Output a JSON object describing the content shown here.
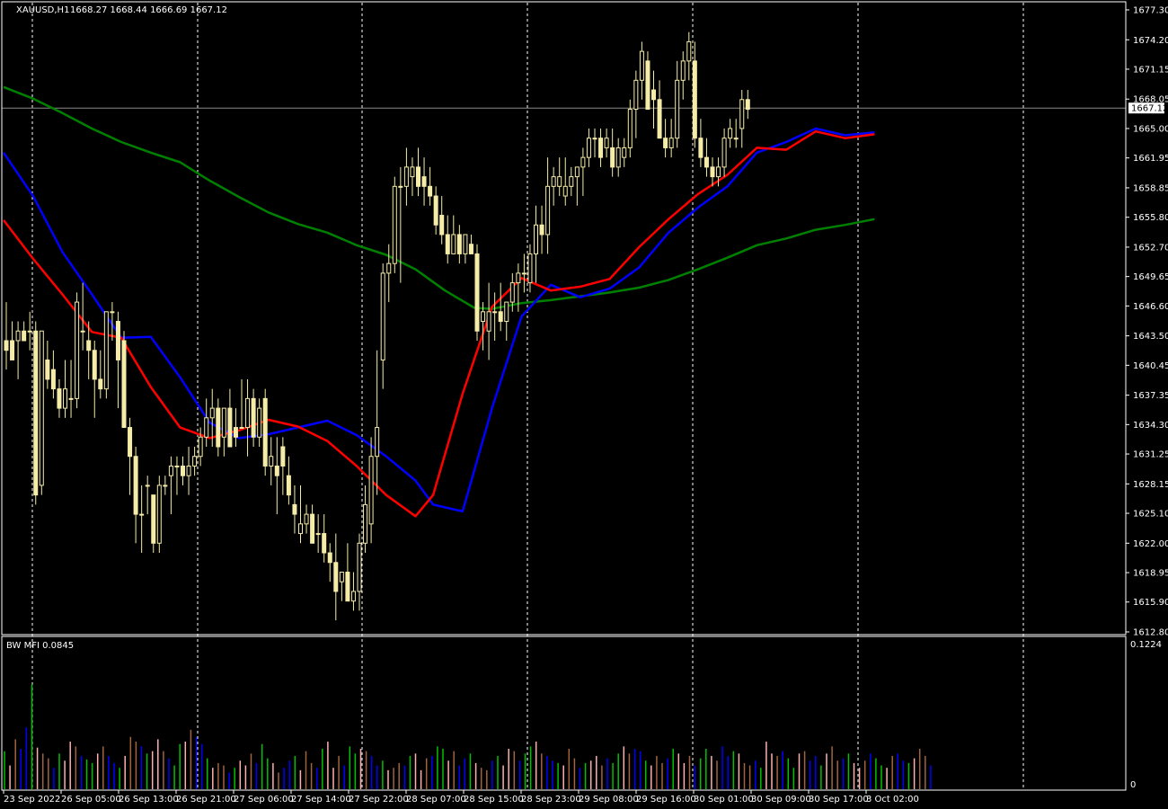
{
  "header": {
    "symbol": "XAUUSD,H1",
    "ohlc": "1668.27 1668.44 1666.69 1667.12"
  },
  "indicator": {
    "title": "BW MFI 0.0845",
    "scale_max": "0.1224",
    "scale_zero": "0"
  },
  "colors": {
    "background": "#000000",
    "frame": "#ffffff",
    "candle": "#f5eca8",
    "ma_fast": "#ff0000",
    "ma_mid": "#0000ff",
    "ma_slow": "#008000",
    "mfi_green": "#00c000",
    "mfi_blue": "#0000ff",
    "mfi_brown": "#a06440",
    "mfi_pink": "#ffb0b0",
    "grid": "#ffffff",
    "price_line": "#8a8a8a"
  },
  "chart_data": {
    "type": "candlestick",
    "symbol": "XAUUSD",
    "timeframe": "H1",
    "y_range": [
      1612.8,
      1677.3
    ],
    "y_ticks": [
      "1677.30",
      "1674.20",
      "1671.15",
      "1668.05",
      "1665.00",
      "1661.95",
      "1658.85",
      "1655.80",
      "1652.70",
      "1649.65",
      "1646.60",
      "1643.50",
      "1640.45",
      "1637.35",
      "1634.30",
      "1631.25",
      "1628.15",
      "1625.10",
      "1622.00",
      "1618.95",
      "1615.90",
      "1612.80"
    ],
    "x_labels": [
      "23 Sep 2022",
      "26 Sep 05:00",
      "26 Sep 13:00",
      "26 Sep 21:00",
      "27 Sep 06:00",
      "27 Sep 14:00",
      "27 Sep 22:00",
      "28 Sep 07:00",
      "28 Sep 15:00",
      "28 Sep 23:00",
      "29 Sep 08:00",
      "29 Sep 16:00",
      "30 Sep 01:00",
      "30 Sep 09:00",
      "30 Sep 17:00",
      "3 Oct 02:00"
    ],
    "current_price": "1667.12",
    "grid": "vertical dotted",
    "candles": [
      [
        1643,
        1647,
        1640,
        1642
      ],
      [
        1643,
        1645,
        1641,
        1641
      ],
      [
        1643,
        1645,
        1639,
        1644
      ],
      [
        1644,
        1645,
        1643,
        1643
      ],
      [
        1644,
        1646,
        1642,
        1644
      ],
      [
        1644,
        1645,
        1626,
        1627
      ],
      [
        1628,
        1644,
        1627,
        1644
      ],
      [
        1641,
        1643,
        1638,
        1639
      ],
      [
        1640,
        1642,
        1637,
        1638
      ],
      [
        1638,
        1639,
        1635,
        1636
      ],
      [
        1636,
        1641,
        1635,
        1638
      ],
      [
        1637,
        1641,
        1635,
        1637
      ],
      [
        1637,
        1648,
        1636,
        1647
      ],
      [
        1644,
        1649,
        1642,
        1644
      ],
      [
        1643,
        1645,
        1639,
        1642
      ],
      [
        1642,
        1643,
        1635,
        1639
      ],
      [
        1639,
        1642,
        1637,
        1638
      ],
      [
        1638,
        1646,
        1637,
        1646
      ],
      [
        1646,
        1647,
        1643,
        1646
      ],
      [
        1645,
        1646,
        1636,
        1641
      ],
      [
        1643,
        1644,
        1634,
        1634
      ],
      [
        1634,
        1635,
        1627,
        1631
      ],
      [
        1631,
        1632,
        1622,
        1625
      ],
      [
        1625,
        1628,
        1621,
        1625
      ],
      [
        1628,
        1629,
        1625,
        1628
      ],
      [
        1627,
        1627,
        1621,
        1622
      ],
      [
        1622,
        1629,
        1621,
        1628
      ],
      [
        1628,
        1629,
        1627,
        1628
      ],
      [
        1629,
        1631,
        1625,
        1630
      ],
      [
        1630,
        1631,
        1627,
        1630
      ],
      [
        1630,
        1631,
        1628,
        1629
      ],
      [
        1629,
        1632,
        1627,
        1630
      ],
      [
        1630,
        1632,
        1629,
        1631
      ],
      [
        1631,
        1634,
        1630,
        1633
      ],
      [
        1633,
        1637,
        1632,
        1635
      ],
      [
        1635,
        1638,
        1632,
        1636
      ],
      [
        1636,
        1637,
        1631,
        1632
      ],
      [
        1633,
        1636,
        1631,
        1636
      ],
      [
        1636,
        1638,
        1632,
        1632
      ],
      [
        1634,
        1636,
        1632,
        1633
      ],
      [
        1634,
        1639,
        1634,
        1634
      ],
      [
        1634,
        1639,
        1631,
        1637
      ],
      [
        1637,
        1638,
        1632,
        1633
      ],
      [
        1633,
        1637,
        1632,
        1636
      ],
      [
        1637,
        1638,
        1629,
        1630
      ],
      [
        1630,
        1633,
        1628,
        1631
      ],
      [
        1630,
        1633,
        1625,
        1629
      ],
      [
        1632,
        1633,
        1627,
        1630
      ],
      [
        1629,
        1631,
        1626,
        1627
      ],
      [
        1626,
        1628,
        1623,
        1625
      ],
      [
        1623,
        1628,
        1622,
        1624
      ],
      [
        1624,
        1626,
        1623,
        1625
      ],
      [
        1625,
        1626,
        1622,
        1622
      ],
      [
        1623,
        1625,
        1621,
        1623
      ],
      [
        1623,
        1625,
        1620,
        1621
      ],
      [
        1621,
        1622,
        1618,
        1620
      ],
      [
        1620,
        1623,
        1614,
        1617
      ],
      [
        1618,
        1619,
        1616,
        1619
      ],
      [
        1619,
        1622,
        1616,
        1616
      ],
      [
        1616,
        1619,
        1615,
        1617
      ],
      [
        1617,
        1623,
        1615,
        1622
      ],
      [
        1622,
        1628,
        1621,
        1626
      ],
      [
        1624,
        1633,
        1622,
        1631
      ],
      [
        1631,
        1642,
        1627,
        1634
      ],
      [
        1641,
        1651,
        1638,
        1650
      ],
      [
        1650,
        1653,
        1647,
        1651
      ],
      [
        1651,
        1660,
        1650,
        1659
      ],
      [
        1659,
        1661,
        1649,
        1659
      ],
      [
        1659,
        1663,
        1657,
        1661
      ],
      [
        1660,
        1662,
        1658,
        1661
      ],
      [
        1661,
        1663,
        1658,
        1659
      ],
      [
        1660,
        1662,
        1657,
        1659
      ],
      [
        1659,
        1661,
        1657,
        1658
      ],
      [
        1658,
        1659,
        1654,
        1655
      ],
      [
        1656,
        1658,
        1653,
        1654
      ],
      [
        1654,
        1656,
        1651,
        1652
      ],
      [
        1652,
        1656,
        1652,
        1654
      ],
      [
        1654,
        1655,
        1651,
        1652
      ],
      [
        1652,
        1654,
        1651,
        1654
      ],
      [
        1653,
        1654,
        1652,
        1652
      ],
      [
        1652,
        1653,
        1643,
        1644
      ],
      [
        1645,
        1647,
        1642,
        1646
      ],
      [
        1644,
        1649,
        1641,
        1646
      ],
      [
        1646,
        1648,
        1643,
        1646
      ],
      [
        1646,
        1649,
        1644,
        1645
      ],
      [
        1645,
        1647,
        1643,
        1647
      ],
      [
        1647,
        1650,
        1646,
        1649
      ],
      [
        1649,
        1651,
        1646,
        1650
      ],
      [
        1650,
        1652,
        1648,
        1650
      ],
      [
        1649,
        1653,
        1648,
        1652
      ],
      [
        1652,
        1657,
        1649,
        1655
      ],
      [
        1655,
        1657,
        1652,
        1654
      ],
      [
        1654,
        1662,
        1652,
        1659
      ],
      [
        1659,
        1661,
        1657,
        1660
      ],
      [
        1659,
        1662,
        1658,
        1660
      ],
      [
        1658,
        1662,
        1657,
        1659
      ],
      [
        1659,
        1661,
        1658,
        1660
      ],
      [
        1660,
        1661,
        1657,
        1661
      ],
      [
        1661,
        1663,
        1658,
        1662
      ],
      [
        1662,
        1665,
        1661,
        1664
      ],
      [
        1664,
        1665,
        1662,
        1664
      ],
      [
        1664,
        1665,
        1661,
        1662
      ],
      [
        1663,
        1665,
        1662,
        1664
      ],
      [
        1663,
        1665,
        1660,
        1661
      ],
      [
        1661,
        1664,
        1660,
        1663
      ],
      [
        1662,
        1664,
        1661,
        1663
      ],
      [
        1663,
        1668,
        1662,
        1667
      ],
      [
        1667,
        1671,
        1664,
        1670
      ],
      [
        1670,
        1674,
        1668,
        1673
      ],
      [
        1672,
        1673,
        1667,
        1667
      ],
      [
        1669,
        1671,
        1665,
        1668
      ],
      [
        1668,
        1670,
        1664,
        1664
      ],
      [
        1664,
        1666,
        1662,
        1663
      ],
      [
        1663,
        1666,
        1662,
        1664
      ],
      [
        1664,
        1672,
        1663,
        1670
      ],
      [
        1670,
        1673,
        1668,
        1672
      ],
      [
        1672,
        1675,
        1670,
        1674
      ],
      [
        1672,
        1674,
        1663,
        1664
      ],
      [
        1664,
        1666,
        1661,
        1662
      ],
      [
        1662,
        1664,
        1660,
        1661
      ],
      [
        1661,
        1662,
        1659,
        1660
      ],
      [
        1660,
        1662,
        1659,
        1661
      ],
      [
        1661,
        1665,
        1660,
        1664
      ],
      [
        1664,
        1666,
        1663,
        1665
      ],
      [
        1664,
        1666,
        1663,
        1664
      ],
      [
        1665,
        1669,
        1663,
        1668
      ],
      [
        1668,
        1669,
        1666,
        1667
      ]
    ],
    "ma_fast": [
      [
        0,
        1655.5
      ],
      [
        5,
        1651.5
      ],
      [
        10,
        1647.8
      ],
      [
        15,
        1643.9
      ],
      [
        20,
        1643.3
      ],
      [
        25,
        1638.2
      ],
      [
        30,
        1634.0
      ],
      [
        35,
        1632.9
      ],
      [
        40,
        1633.7
      ],
      [
        45,
        1634.8
      ],
      [
        50,
        1634.1
      ],
      [
        55,
        1632.6
      ],
      [
        60,
        1630.0
      ],
      [
        65,
        1627.0
      ],
      [
        70,
        1624.8
      ],
      [
        73,
        1627.0
      ],
      [
        78,
        1637.5
      ],
      [
        83,
        1646.5
      ],
      [
        88,
        1649.5
      ],
      [
        93,
        1648.2
      ],
      [
        98,
        1648.6
      ],
      [
        103,
        1649.4
      ],
      [
        108,
        1652.7
      ],
      [
        113,
        1655.6
      ],
      [
        118,
        1658.2
      ],
      [
        123,
        1660.2
      ],
      [
        128,
        1663.0
      ],
      [
        133,
        1662.8
      ],
      [
        138,
        1664.7
      ],
      [
        143,
        1664.0
      ],
      [
        148,
        1664.4
      ]
    ],
    "ma_mid": [
      [
        0,
        1662.5
      ],
      [
        5,
        1658.0
      ],
      [
        10,
        1652.2
      ],
      [
        15,
        1647.8
      ],
      [
        20,
        1643.3
      ],
      [
        25,
        1643.4
      ],
      [
        30,
        1639.2
      ],
      [
        35,
        1634.5
      ],
      [
        40,
        1632.9
      ],
      [
        45,
        1633.3
      ],
      [
        50,
        1634.0
      ],
      [
        55,
        1634.7
      ],
      [
        60,
        1633.2
      ],
      [
        65,
        1631.0
      ],
      [
        70,
        1628.5
      ],
      [
        73,
        1626.0
      ],
      [
        78,
        1625.3
      ],
      [
        83,
        1636.0
      ],
      [
        88,
        1645.5
      ],
      [
        93,
        1648.8
      ],
      [
        98,
        1647.5
      ],
      [
        103,
        1648.4
      ],
      [
        108,
        1650.6
      ],
      [
        113,
        1654.2
      ],
      [
        118,
        1656.8
      ],
      [
        123,
        1659.0
      ],
      [
        128,
        1662.5
      ],
      [
        133,
        1663.6
      ],
      [
        138,
        1665.0
      ],
      [
        143,
        1664.3
      ],
      [
        148,
        1664.6
      ]
    ],
    "ma_slow": [
      [
        0,
        1669.3
      ],
      [
        5,
        1668.1
      ],
      [
        10,
        1666.6
      ],
      [
        15,
        1665.0
      ],
      [
        20,
        1663.6
      ],
      [
        25,
        1662.5
      ],
      [
        30,
        1661.5
      ],
      [
        35,
        1659.6
      ],
      [
        40,
        1657.9
      ],
      [
        45,
        1656.3
      ],
      [
        50,
        1655.1
      ],
      [
        55,
        1654.2
      ],
      [
        60,
        1652.9
      ],
      [
        65,
        1651.9
      ],
      [
        70,
        1650.4
      ],
      [
        75,
        1648.2
      ],
      [
        80,
        1646.4
      ],
      [
        83,
        1646.3
      ],
      [
        88,
        1646.9
      ],
      [
        93,
        1647.2
      ],
      [
        98,
        1647.6
      ],
      [
        103,
        1648.0
      ],
      [
        108,
        1648.5
      ],
      [
        113,
        1649.3
      ],
      [
        118,
        1650.4
      ],
      [
        123,
        1651.6
      ],
      [
        128,
        1652.9
      ],
      [
        133,
        1653.6
      ],
      [
        138,
        1654.5
      ],
      [
        143,
        1655.0
      ],
      [
        148,
        1655.6
      ]
    ],
    "mfi": [
      0.032,
      0.02,
      0.042,
      0.034,
      0.052,
      0.088,
      0.035,
      0.03,
      0.026,
      0.018,
      0.03,
      0.024,
      0.04,
      0.036,
      0.028,
      0.025,
      0.022,
      0.03,
      0.036,
      0.028,
      0.022,
      0.018,
      0.028,
      0.044,
      0.04,
      0.036,
      0.03,
      0.032,
      0.042,
      0.032,
      0.026,
      0.02,
      0.038,
      0.04,
      0.05,
      0.044,
      0.038,
      0.026,
      0.018,
      0.022,
      0.02,
      0.014,
      0.018,
      0.024,
      0.02,
      0.03,
      0.022,
      0.038,
      0.026,
      0.022,
      0.014,
      0.018,
      0.024,
      0.028,
      0.016,
      0.032,
      0.022,
      0.018,
      0.034,
      0.04,
      0.018,
      0.028,
      0.02,
      0.036,
      0.03,
      0.034,
      0.032,
      0.028,
      0.02,
      0.024,
      0.016,
      0.018,
      0.022,
      0.02,
      0.028,
      0.03,
      0.016,
      0.026,
      0.028,
      0.036,
      0.034,
      0.024,
      0.032,
      0.02,
      0.026,
      0.03,
      0.022,
      0.018,
      0.016,
      0.024,
      0.028,
      0.02,
      0.034,
      0.032,
      0.024,
      0.03,
      0.036,
      0.04,
      0.03,
      0.028,
      0.024,
      0.022,
      0.02,
      0.034,
      0.026,
      0.018,
      0.022,
      0.024,
      0.028,
      0.02,
      0.026,
      0.022,
      0.03,
      0.036,
      0.03,
      0.034,
      0.032,
      0.024,
      0.02,
      0.028,
      0.022,
      0.026,
      0.034,
      0.03,
      0.022,
      0.028,
      0.02,
      0.026,
      0.034,
      0.028,
      0.024,
      0.036,
      0.028,
      0.032,
      0.03,
      0.022,
      0.02,
      0.024,
      0.018,
      0.04,
      0.03,
      0.028,
      0.032,
      0.026,
      0.018,
      0.03,
      0.032,
      0.024,
      0.028,
      0.02,
      0.03,
      0.036,
      0.024,
      0.026,
      0.03,
      0.022,
      0.018,
      0.024,
      0.03,
      0.026,
      0.02,
      0.018,
      0.028,
      0.03,
      0.024,
      0.022,
      0.026,
      0.034,
      0.028,
      0.02
    ],
    "mfi_scale": [
      0,
      0.1224
    ]
  }
}
